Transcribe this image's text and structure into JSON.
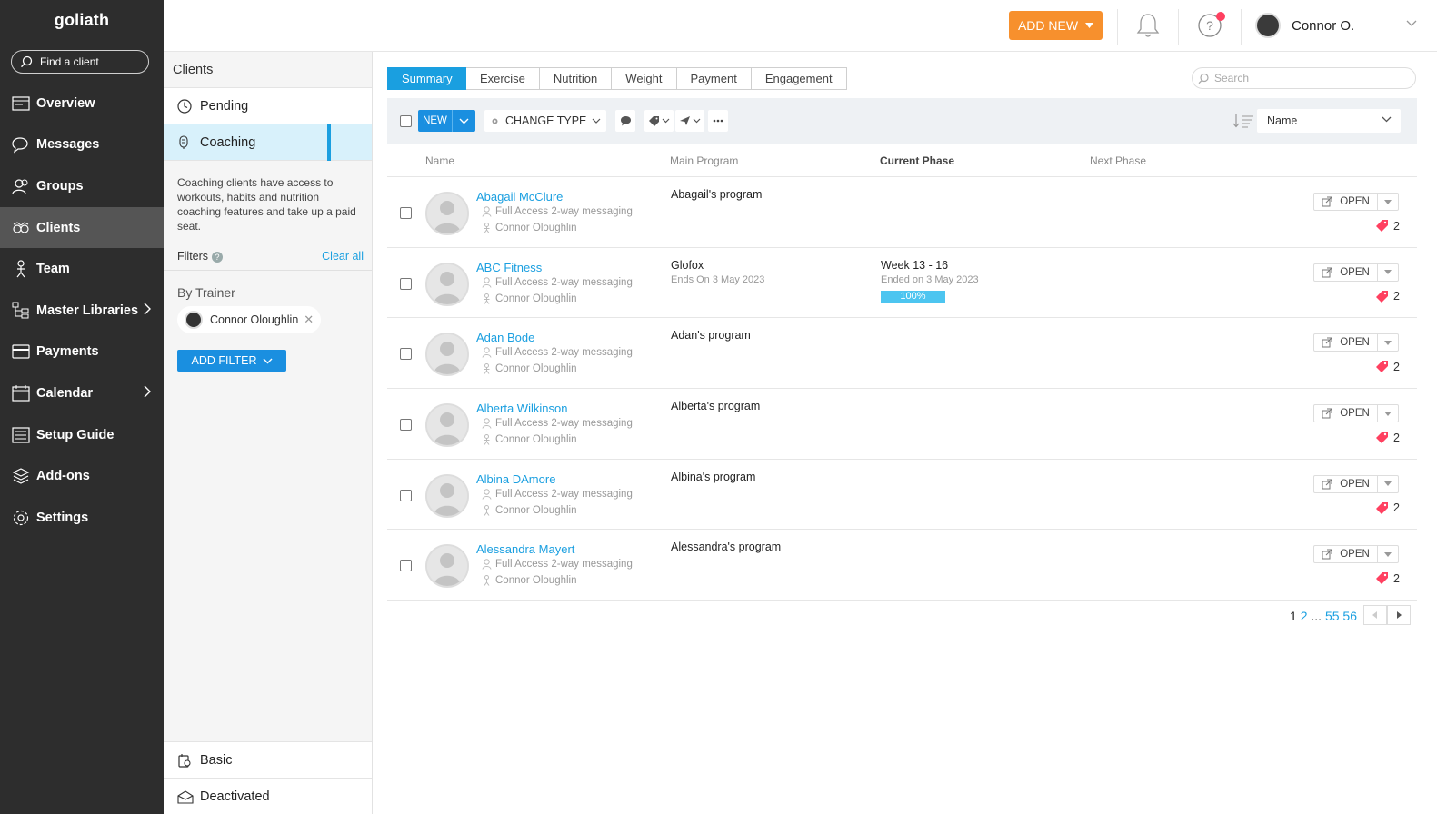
{
  "brand": {
    "name": "goliath"
  },
  "nav": {
    "find_placeholder": "Find a client",
    "items": [
      {
        "label": "Overview",
        "icon": "overview-icon"
      },
      {
        "label": "Messages",
        "icon": "messages-icon"
      },
      {
        "label": "Groups",
        "icon": "groups-icon"
      },
      {
        "label": "Clients",
        "icon": "clients-icon"
      },
      {
        "label": "Team",
        "icon": "team-icon"
      },
      {
        "label": "Master Libraries",
        "icon": "master-libraries-icon"
      },
      {
        "label": "Payments",
        "icon": "payments-icon"
      },
      {
        "label": "Calendar",
        "icon": "calendar-icon"
      },
      {
        "label": "Setup Guide",
        "icon": "setup-guide-icon"
      },
      {
        "label": "Add-ons",
        "icon": "add-ons-icon"
      },
      {
        "label": "Settings",
        "icon": "settings-icon"
      }
    ]
  },
  "header": {
    "add_new_label": "ADD NEW",
    "user_name": "Connor O."
  },
  "sidepanel": {
    "title": "Clients",
    "pending_label": "Pending",
    "coaching_label": "Coaching",
    "description": "Coaching clients have access to workouts, habits and nutrition coaching features and take up a paid seat.",
    "filters_label": "Filters",
    "clear_all_label": "Clear all",
    "by_trainer_label": "By Trainer",
    "trainer_chip": "Connor Oloughlin",
    "add_filter_label": "ADD FILTER",
    "basic_label": "Basic",
    "deactivated_label": "Deactivated"
  },
  "tabs": [
    "Summary",
    "Exercise",
    "Nutrition",
    "Weight",
    "Payment",
    "Engagement"
  ],
  "search": {
    "placeholder": "Search"
  },
  "toolbar": {
    "new_label": "NEW",
    "change_type_label": "CHANGE TYPE",
    "sort_value": "Name"
  },
  "table": {
    "columns": [
      "Name",
      "Main Program",
      "Current Phase",
      "Next Phase"
    ],
    "open_label": "OPEN",
    "rows": [
      {
        "name": "Abagail McClure",
        "access": "Full Access 2-way messaging",
        "trainer": "Connor Oloughlin",
        "program": "Abagail's program",
        "tags": "2"
      },
      {
        "name": "ABC Fitness",
        "access": "Full Access 2-way messaging",
        "trainer": "Connor Oloughlin",
        "program": "Glofox",
        "program_sub": "Ends On 3 May 2023",
        "phase": "Week 13 - 16",
        "phase_sub": "Ended on 3 May 2023",
        "phase_progress": "100%",
        "tags": "2"
      },
      {
        "name": "Adan Bode",
        "access": "Full Access 2-way messaging",
        "trainer": "Connor Oloughlin",
        "program": "Adan's program",
        "tags": "2"
      },
      {
        "name": "Alberta Wilkinson",
        "access": "Full Access 2-way messaging",
        "trainer": "Connor Oloughlin",
        "program": "Alberta's program",
        "tags": "2"
      },
      {
        "name": "Albina DAmore",
        "access": "Full Access 2-way messaging",
        "trainer": "Connor Oloughlin",
        "program": "Albina's program",
        "tags": "2"
      },
      {
        "name": "Alessandra Mayert",
        "access": "Full Access 2-way messaging",
        "trainer": "Connor Oloughlin",
        "program": "Alessandra's program",
        "tags": "2"
      }
    ]
  },
  "pagination": {
    "p1": "1",
    "p2": "2",
    "dots": "...",
    "p55": "55",
    "p56": "56"
  },
  "colors": {
    "accent": "#1a9fe0",
    "orange": "#f7902d",
    "nav_bg": "#2d2d2d",
    "tag_red": "#ff4060"
  }
}
